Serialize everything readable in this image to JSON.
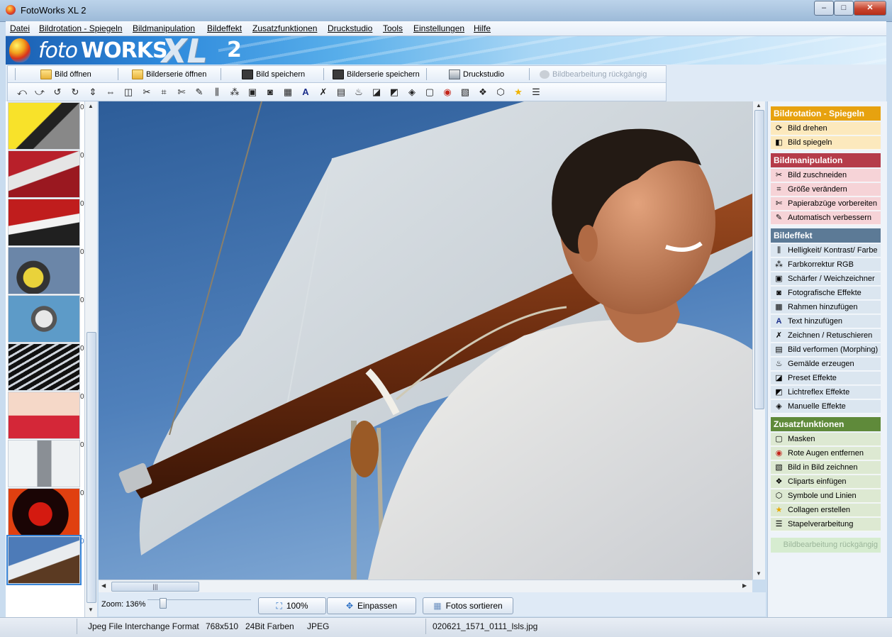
{
  "window": {
    "title": "FotoWorks XL 2",
    "minimize": "‒",
    "maximize": "□",
    "close": "✕"
  },
  "menu": [
    "Datei",
    "Bildrotation - Spiegeln",
    "Bildmanipulation",
    "Bildeffekt",
    "Zusatzfunktionen",
    "Druckstudio",
    "Tools",
    "Einstellungen",
    "Hilfe"
  ],
  "logo": {
    "foto": "foto",
    "works": "WORKS",
    "xl": "XL",
    "version": "2"
  },
  "toolbar": {
    "open": "Bild öffnen",
    "open_series": "Bilderserie öffnen",
    "save": "Bild speichern",
    "save_series": "Bilderserie speichern",
    "print_studio": "Druckstudio",
    "undo": "Bildbearbeitung rückgängig"
  },
  "thumbnails": {
    "count_marks": [
      "0",
      "0",
      "0",
      "0",
      "0",
      "0",
      "0",
      "0",
      "0",
      "0"
    ],
    "selected_index": 9
  },
  "bottom": {
    "zoom_label": "Zoom: 136%",
    "zoom_fraction": 0.12,
    "btn_100": "100%",
    "btn_fit": "Einpassen",
    "btn_sort": "Fotos sortieren"
  },
  "right_panel": {
    "sections": [
      {
        "title": "Bildrotation - Spiegeln",
        "color": "#e7a20f",
        "item_bg": "#fce9bd",
        "items": [
          {
            "label": "Bild drehen",
            "icon": "rotate-image-icon"
          },
          {
            "label": "Bild spiegeln",
            "icon": "mirror-image-icon"
          }
        ]
      },
      {
        "title": "Bildmanipulation",
        "color": "#b53c4a",
        "item_bg": "#f6d3d7",
        "items": [
          {
            "label": "Bild zuschneiden",
            "icon": "scissors-icon"
          },
          {
            "label": "Größe verändern",
            "icon": "resize-icon"
          },
          {
            "label": "Papierabzüge vorbereiten",
            "icon": "paper-cut-icon"
          },
          {
            "label": "Automatisch verbessern",
            "icon": "magic-wand-icon"
          }
        ]
      },
      {
        "title": "Bildeffekt",
        "color": "#5c7a96",
        "item_bg": "#dbe6f0",
        "items": [
          {
            "label": "Helligkeit/ Kontrast/ Farbe",
            "icon": "brightness-icon"
          },
          {
            "label": "Farbkorrektur RGB",
            "icon": "rgb-icon"
          },
          {
            "label": "Schärfer / Weichzeichner",
            "icon": "sharpen-icon"
          },
          {
            "label": "Fotografische Effekte",
            "icon": "camera-icon"
          },
          {
            "label": "Rahmen hinzufügen",
            "icon": "frame-icon"
          },
          {
            "label": "Text hinzufügen",
            "icon": "text-icon"
          },
          {
            "label": "Zeichnen / Retuschieren",
            "icon": "draw-icon"
          },
          {
            "label": "Bild verformen (Morphing)",
            "icon": "morph-icon"
          },
          {
            "label": "Gemälde erzeugen",
            "icon": "brush-icon"
          },
          {
            "label": "Preset Effekte",
            "icon": "preset-icon"
          },
          {
            "label": "Lichtreflex Effekte",
            "icon": "lens-flare-icon"
          },
          {
            "label": "Manuelle Effekte",
            "icon": "manual-effects-icon"
          }
        ]
      },
      {
        "title": "Zusatzfunktionen",
        "color": "#5f8a3a",
        "item_bg": "#dde9d2",
        "items": [
          {
            "label": "Masken",
            "icon": "mask-icon"
          },
          {
            "label": "Rote Augen entfernen",
            "icon": "red-eye-icon"
          },
          {
            "label": "Bild in Bild zeichnen",
            "icon": "picture-in-picture-icon"
          },
          {
            "label": "Cliparts einfügen",
            "icon": "clipart-icon"
          },
          {
            "label": "Symbole und Linien",
            "icon": "symbols-icon"
          },
          {
            "label": "Collagen erstellen",
            "icon": "star-icon"
          },
          {
            "label": "Stapelverarbeitung",
            "icon": "batch-icon"
          }
        ]
      }
    ],
    "undo": "Bildbearbeitung rückgängig"
  },
  "status": {
    "format": "Jpeg File Interchange Format",
    "dimensions": "768x510",
    "depth": "24Bit Farben",
    "type": "JPEG",
    "filename": "020621_1571_0111_lsls.jpg"
  }
}
